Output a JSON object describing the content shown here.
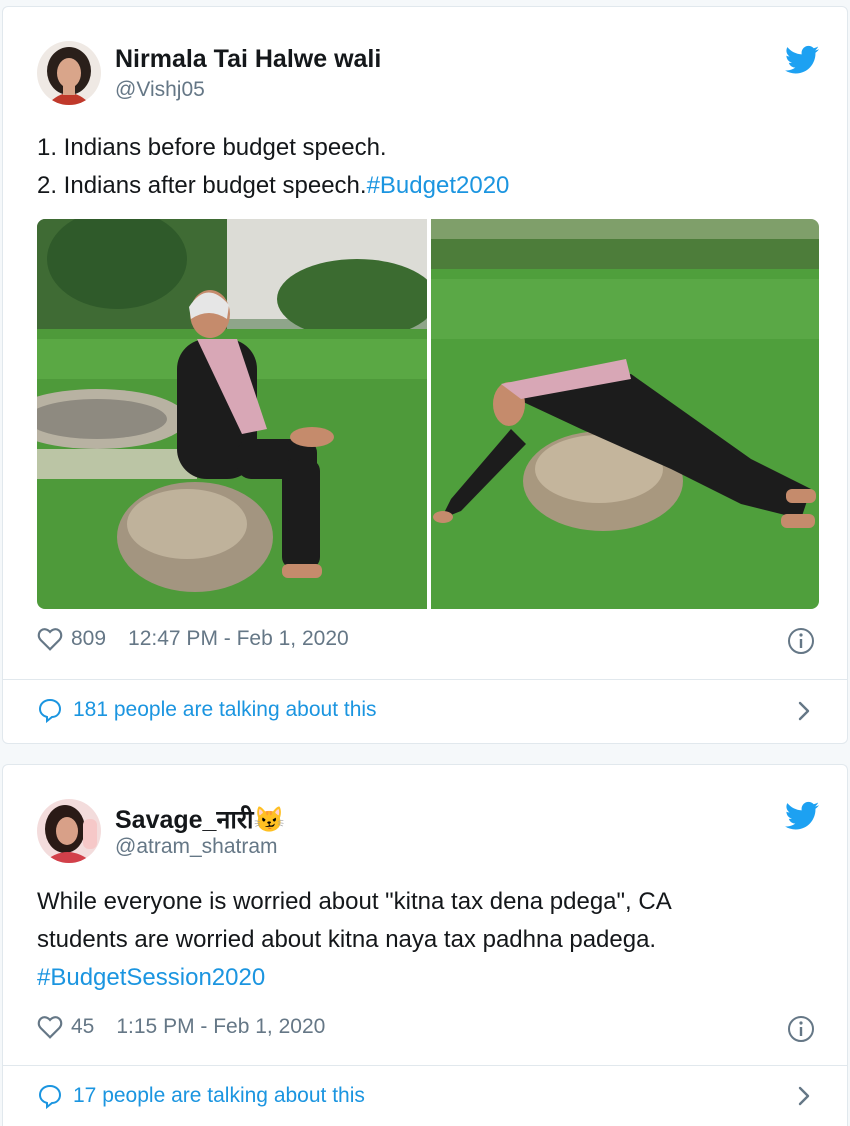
{
  "tweets": [
    {
      "author_name": "Nirmala Tai Halwe wali",
      "author_handle": "@Vishj05",
      "text_line1": "1. Indians before budget speech.",
      "text_line2": "2. Indians after budget speech.",
      "hashtag": "#Budget2020",
      "likes": "809",
      "timestamp": "12:47 PM - Feb 1, 2020",
      "talking": "181 people are talking about this",
      "icons": [
        "twitter-bird-icon",
        "heart-icon",
        "info-icon",
        "speech-bubble-icon",
        "chevron-right-icon"
      ]
    },
    {
      "author_name": "Savage_नारी",
      "author_emoji": "😼",
      "author_handle": "@atram_shatram",
      "text_line1": "While everyone is worried about \"kitna tax dena pdega\",  CA",
      "text_line2": "students are worried about kitna naya tax padhna padega.",
      "hashtag": "#BudgetSession2020",
      "likes": "45",
      "timestamp": "1:15 PM - Feb 1, 2020",
      "talking": "17 people are talking about this",
      "icons": [
        "twitter-bird-icon",
        "heart-icon",
        "info-icon",
        "speech-bubble-icon",
        "chevron-right-icon"
      ]
    }
  ],
  "colors": {
    "accent": "#1b95e0",
    "secondary_text": "#657786",
    "border": "#e1e8ed",
    "background": "#f5f8fa"
  }
}
